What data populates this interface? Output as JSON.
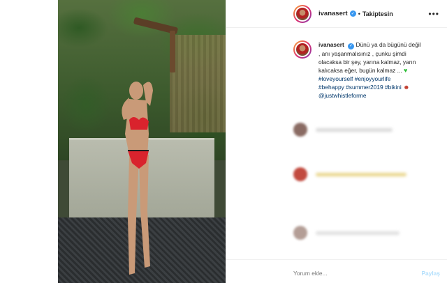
{
  "header": {
    "username": "ivanasert",
    "separator": "•",
    "follow_label": "Takiptesin",
    "more_icon": "more-horizontal-icon"
  },
  "caption": {
    "username": "ivanasert",
    "lines": [
      "Dünü ya da bügünü değil",
      ", anı yaşanmalısınız , çunku şimdi",
      "olacaksa bir şey, yarına kalmaz, yarın",
      "kalıcaksa eğer, bugün kalmaz ..."
    ],
    "hashtags": {
      "line1": [
        "#loveyourself",
        "#enjoyyourlife"
      ],
      "line2": [
        "#behappy",
        "#summer2019",
        "#bikini"
      ],
      "mention": "@justwhistleforme"
    },
    "emoji_green_heart": "♥",
    "emoji_devil": "☻"
  },
  "comments": {
    "placeholder": "Yorum ekle...",
    "post_label": "Paylaş"
  },
  "colors": {
    "link": "#00376b",
    "verified": "#3897f0",
    "border": "#efefef",
    "muted": "#8e8e8e"
  }
}
